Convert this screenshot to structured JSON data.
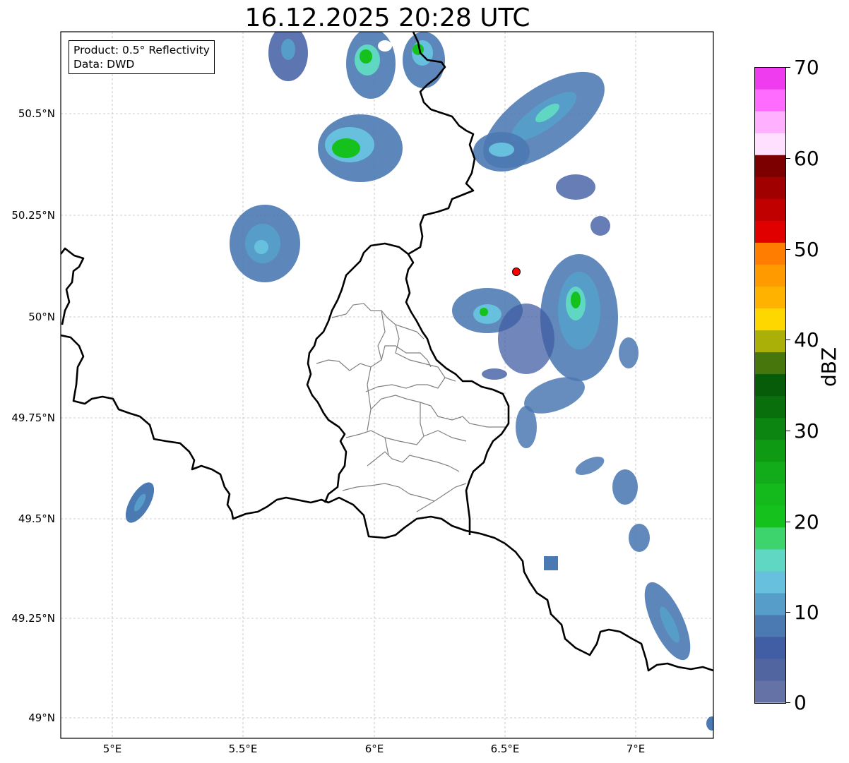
{
  "title": "16.12.2025 20:28 UTC",
  "info": {
    "product": "Product: 0.5° Reflectivity",
    "source": "Data: DWD"
  },
  "map": {
    "lon_range": [
      4.8,
      7.3
    ],
    "lat_range": [
      48.95,
      50.7
    ],
    "lon_ticks": [
      "5°E",
      "5.5°E",
      "6°E",
      "6.5°E",
      "7°E"
    ],
    "lat_ticks": [
      "50.5°N",
      "50.25°N",
      "50°N",
      "49.75°N",
      "49.5°N",
      "49.25°N",
      "49°N"
    ],
    "radar_site_color": "#ff0000",
    "border_color": "#000000",
    "district_color": "#808080"
  },
  "colorbar": {
    "label": "dBZ",
    "ticks": [
      "70",
      "60",
      "50",
      "40",
      "30",
      "20",
      "10",
      "0"
    ],
    "colors": [
      "#6472a6",
      "#5166a1",
      "#415da3",
      "#4b79b2",
      "#579dca",
      "#66c0de",
      "#5fd7c2",
      "#3dd46d",
      "#15c21d",
      "#14b91b",
      "#12ab19",
      "#0f9a14",
      "#0c8511",
      "#096f0d",
      "#075c0a",
      "#46760c",
      "#aab007",
      "#ffd700",
      "#ffb300",
      "#ff9a00",
      "#ff7d00",
      "#e00000",
      "#c00000",
      "#a00000",
      "#7d0000",
      "#ffe0ff",
      "#ffb0ff",
      "#ff6cff",
      "#ee3cee"
    ]
  }
}
